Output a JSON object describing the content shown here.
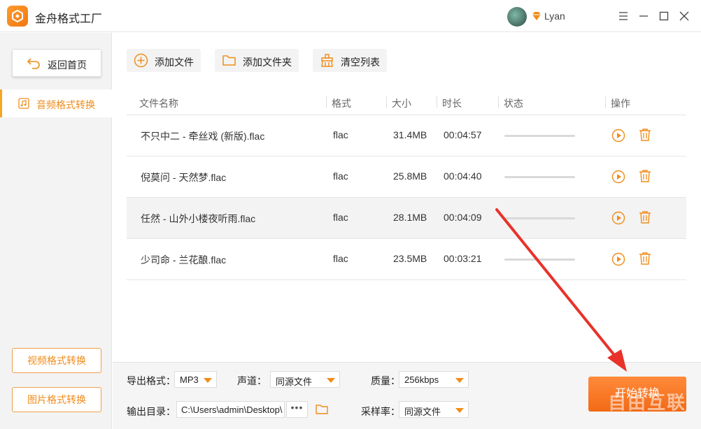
{
  "window": {
    "title": "金舟格式工厂",
    "user": {
      "name": "Lyan"
    }
  },
  "sidebar": {
    "back_label": "返回首页",
    "active_item": "音频格式转换",
    "video_label": "视频格式转换",
    "image_label": "图片格式转换"
  },
  "toolbar": {
    "add_file": "添加文件",
    "add_folder": "添加文件夹",
    "clear_list": "清空列表"
  },
  "table": {
    "headers": {
      "name": "文件名称",
      "format": "格式",
      "size": "大小",
      "duration": "时长",
      "status": "状态",
      "actions": "操作"
    },
    "rows": [
      {
        "name": "不只中二 - 牵丝戏 (新版).flac",
        "format": "flac",
        "size": "31.4MB",
        "duration": "00:04:57"
      },
      {
        "name": "倪莫问 - 天然梦.flac",
        "format": "flac",
        "size": "25.8MB",
        "duration": "00:04:40"
      },
      {
        "name": "任然 - 山外小楼夜听雨.flac",
        "format": "flac",
        "size": "28.1MB",
        "duration": "00:04:09"
      },
      {
        "name": "少司命 - 兰花酿.flac",
        "format": "flac",
        "size": "23.5MB",
        "duration": "00:03:21"
      }
    ]
  },
  "settings": {
    "export_format_label": "导出格式：",
    "export_format_value": "MP3",
    "channel_label": "声道：",
    "channel_value": "同源文件",
    "quality_label": "质量：",
    "quality_value": "256kbps",
    "output_dir_label": "输出目录：",
    "output_dir_value": "C:\\Users\\admin\\Desktop\\",
    "more_label": "•••",
    "sample_rate_label": "采样率：",
    "sample_rate_value": "同源文件"
  },
  "start_button": "开始转换",
  "watermark": "自由互联",
  "colors": {
    "accent": "#f08c1a",
    "start": "#f26a16",
    "arrow": "#e8322a"
  }
}
